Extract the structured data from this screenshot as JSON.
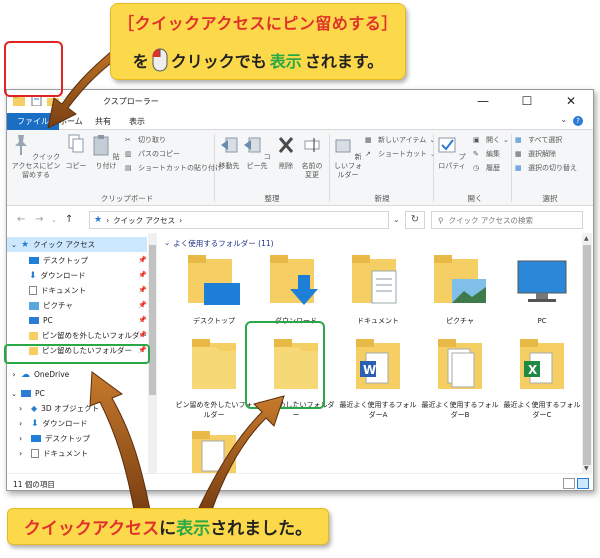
{
  "window": {
    "title": "クイック アクセス - エクスプローラー",
    "title_visible": "クスプローラー",
    "controls": {
      "minimize": "—",
      "maximize": "☐",
      "close": "✕"
    }
  },
  "tabs": {
    "file": "ファイル",
    "home": "ホーム",
    "share": "共有",
    "view": "表示"
  },
  "ribbon": {
    "pin": "クイック アクセスにピン留めする",
    "copy": "コピー",
    "paste": "貼り付け",
    "cut": "切り取り",
    "copy_path": "パスのコピー",
    "paste_shortcut": "ショートカットの貼り付け",
    "clipboard_group": "クリップボード",
    "move_to": "移動先",
    "copy_to": "コピー先",
    "delete": "削除",
    "rename": "名前の変更",
    "organize_group": "整理",
    "new_folder": "新しいフォルダー",
    "new_item": "新しいアイテム",
    "shortcut": "ショートカット",
    "new_group": "新規",
    "properties": "プロパティ",
    "open": "開く",
    "edit": "編集",
    "history": "履歴",
    "open_group": "開く",
    "select_all": "すべて選択",
    "select_none": "選択解除",
    "invert_selection": "選択の切り替え",
    "select_group": "選択"
  },
  "address": {
    "path": "クイック アクセス",
    "search_placeholder": "クイック アクセスの検索"
  },
  "nav": {
    "quick_access": "クイック アクセス",
    "pinned": [
      {
        "label": "デスクトップ"
      },
      {
        "label": "ダウンロード"
      },
      {
        "label": "ドキュメント"
      },
      {
        "label": "ピクチャ"
      },
      {
        "label": "PC"
      },
      {
        "label": "ピン留めを外したいフォルダー"
      },
      {
        "label": "ピン留めしたいフォルダー"
      }
    ],
    "onedrive": "OneDrive",
    "pc": "PC",
    "pc_children": [
      {
        "label": "3D オブジェクト"
      },
      {
        "label": "ダウンロード"
      },
      {
        "label": "デスクトップ"
      },
      {
        "label": "ドキュメント"
      }
    ]
  },
  "content": {
    "group_header": "よく使用するフォルダー (11)",
    "items": [
      {
        "label": "デスクトップ"
      },
      {
        "label": "ダウンロード"
      },
      {
        "label": "ドキュメント"
      },
      {
        "label": "ピクチャ"
      },
      {
        "label": "PC"
      },
      {
        "label": "ピン留めを外したいフォルダー"
      },
      {
        "label": "ピン留めしたいフォルダー"
      },
      {
        "label": "最近よく使用するフォルダーA"
      },
      {
        "label": "最近よく使用するフォルダーB"
      },
      {
        "label": "最近よく使用するフォルダーC"
      }
    ]
  },
  "status": {
    "count": "11 個の項目"
  },
  "callouts": {
    "top_line1": "［クイックアクセスにピン留めする］",
    "top_line2_a": "を",
    "top_line2_b": "クリックでも",
    "top_line2_c": "表示",
    "top_line2_d": "されます。",
    "bottom_a": "クイックアクセス",
    "bottom_b": "に",
    "bottom_c": "表示",
    "bottom_d": "されました。"
  },
  "colors": {
    "accent": "#1a6fc4",
    "callout": "#fcd94a",
    "red": "#e0312c",
    "green": "#2aa845",
    "folder": "#f5cf63"
  }
}
